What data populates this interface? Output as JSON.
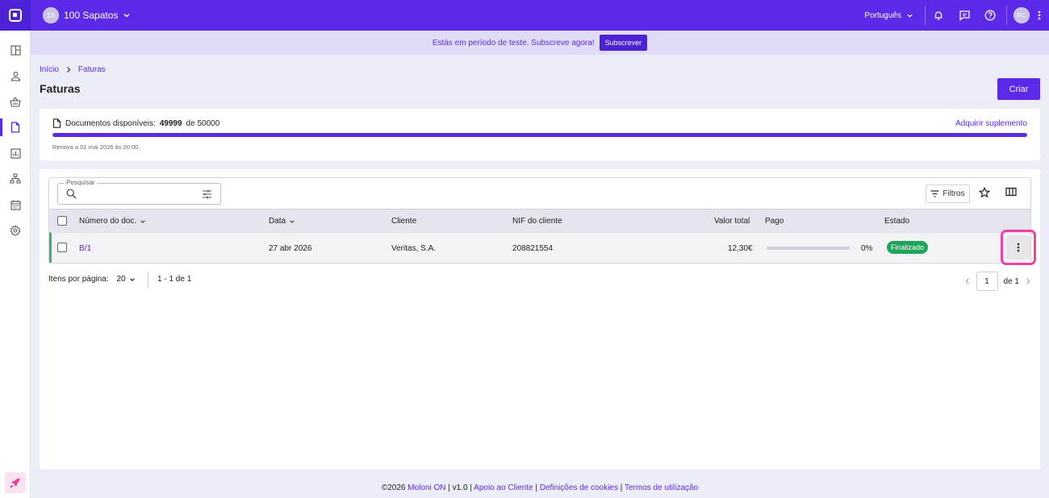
{
  "topbar": {
    "company_initials": "1S",
    "company_name": "100 Sapatos",
    "language": "Português",
    "user_initials": "RC"
  },
  "banner": {
    "text": "Estás em período de teste. Subscreve agora!",
    "button": "Subscrever"
  },
  "breadcrumb": [
    "Início",
    "Faturas"
  ],
  "page_title": "Faturas",
  "create_button": "Criar",
  "documents": {
    "label": "Documentos disponíveis:",
    "available": "49999",
    "of_text": "de 50000",
    "addon_link": "Adquirir suplemento",
    "renew_text": "Renova a 01 mai 2026 às 00:00.",
    "usage_fraction": 0.99998
  },
  "search": {
    "label": "Pesquisar",
    "value": ""
  },
  "toolbar": {
    "filters_label": "Filtros"
  },
  "table": {
    "columns": {
      "number": "Número do doc.",
      "date": "Data",
      "client": "Cliente",
      "nif": "NIF do cliente",
      "total": "Valor total",
      "paid": "Pago",
      "status": "Estado"
    },
    "rows": [
      {
        "number": "B/1",
        "date": "27 abr 2026",
        "client": "Veritas, S.A.",
        "nif": "208821554",
        "total": "12,30€",
        "paid_percent": "0%",
        "status": "Finalizado"
      }
    ]
  },
  "pagination": {
    "items_per_page_label": "Itens por página:",
    "items_per_page": "20",
    "range": "1 - 1 de 1",
    "current_page": "1",
    "of_pages": "de 1"
  },
  "footer": {
    "copyright": "©2026",
    "brand": "Moloni ON",
    "version": "v1.0",
    "support": "Apoio ao Cliente",
    "cookies": "Definições de cookies",
    "terms": "Termos de utilização"
  },
  "colors": {
    "primary": "#5a2ae8",
    "success": "#1fa55b",
    "highlight": "#f23fa4"
  }
}
